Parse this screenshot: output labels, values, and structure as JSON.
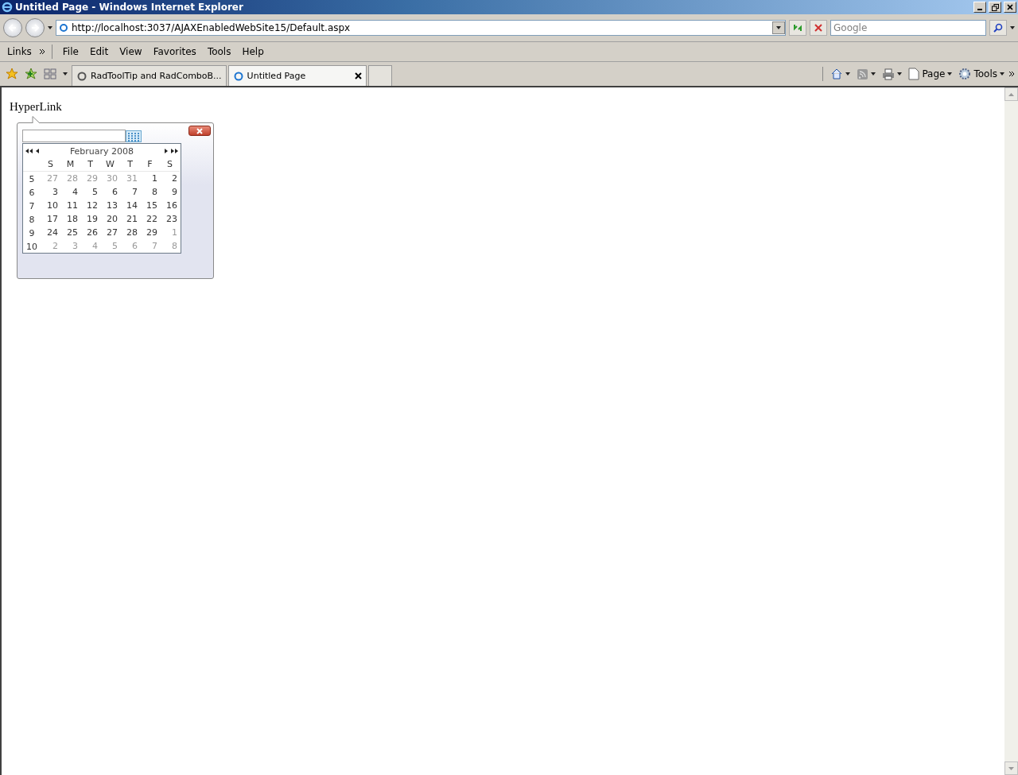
{
  "window": {
    "title": "Untitled Page - Windows Internet Explorer"
  },
  "address_bar": {
    "url": "http://localhost:3037/AJAXEnabledWebSite15/Default.aspx"
  },
  "search": {
    "placeholder": "Google"
  },
  "links_bar": {
    "label": "Links"
  },
  "menu": [
    "File",
    "Edit",
    "View",
    "Favorites",
    "Tools",
    "Help"
  ],
  "tabs": [
    {
      "label": "RadToolTip and RadComboB...",
      "selected": false
    },
    {
      "label": "Untitled Page",
      "selected": true
    }
  ],
  "command_bar": {
    "page": "Page",
    "tools": "Tools"
  },
  "page": {
    "link": "HyperLink",
    "calendar": {
      "title": "February 2008",
      "weekdays": [
        "S",
        "M",
        "T",
        "W",
        "T",
        "F",
        "S"
      ],
      "weeks": [
        {
          "number": "5",
          "days": [
            {
              "text": "27",
              "other_month": true
            },
            {
              "text": "28",
              "other_month": true
            },
            {
              "text": "29",
              "other_month": true
            },
            {
              "text": "30",
              "other_month": true
            },
            {
              "text": "31",
              "other_month": true
            },
            {
              "text": "1",
              "other_month": false
            },
            {
              "text": "2",
              "other_month": false
            }
          ]
        },
        {
          "number": "6",
          "days": [
            {
              "text": "3",
              "other_month": false
            },
            {
              "text": "4",
              "other_month": false
            },
            {
              "text": "5",
              "other_month": false
            },
            {
              "text": "6",
              "other_month": false
            },
            {
              "text": "7",
              "other_month": false
            },
            {
              "text": "8",
              "other_month": false
            },
            {
              "text": "9",
              "other_month": false
            }
          ]
        },
        {
          "number": "7",
          "days": [
            {
              "text": "10",
              "other_month": false
            },
            {
              "text": "11",
              "other_month": false
            },
            {
              "text": "12",
              "other_month": false
            },
            {
              "text": "13",
              "other_month": false
            },
            {
              "text": "14",
              "other_month": false
            },
            {
              "text": "15",
              "other_month": false
            },
            {
              "text": "16",
              "other_month": false
            }
          ]
        },
        {
          "number": "8",
          "days": [
            {
              "text": "17",
              "other_month": false
            },
            {
              "text": "18",
              "other_month": false
            },
            {
              "text": "19",
              "other_month": false
            },
            {
              "text": "20",
              "other_month": false
            },
            {
              "text": "21",
              "other_month": false
            },
            {
              "text": "22",
              "other_month": false
            },
            {
              "text": "23",
              "other_month": false
            }
          ]
        },
        {
          "number": "9",
          "days": [
            {
              "text": "24",
              "other_month": false
            },
            {
              "text": "25",
              "other_month": false
            },
            {
              "text": "26",
              "other_month": false
            },
            {
              "text": "27",
              "other_month": false
            },
            {
              "text": "28",
              "other_month": false
            },
            {
              "text": "29",
              "other_month": false
            },
            {
              "text": "1",
              "other_month": true
            }
          ]
        },
        {
          "number": "10",
          "days": [
            {
              "text": "2",
              "other_month": true
            },
            {
              "text": "3",
              "other_month": true
            },
            {
              "text": "4",
              "other_month": true
            },
            {
              "text": "5",
              "other_month": true
            },
            {
              "text": "6",
              "other_month": true
            },
            {
              "text": "7",
              "other_month": true
            },
            {
              "text": "8",
              "other_month": true
            }
          ]
        }
      ]
    }
  }
}
